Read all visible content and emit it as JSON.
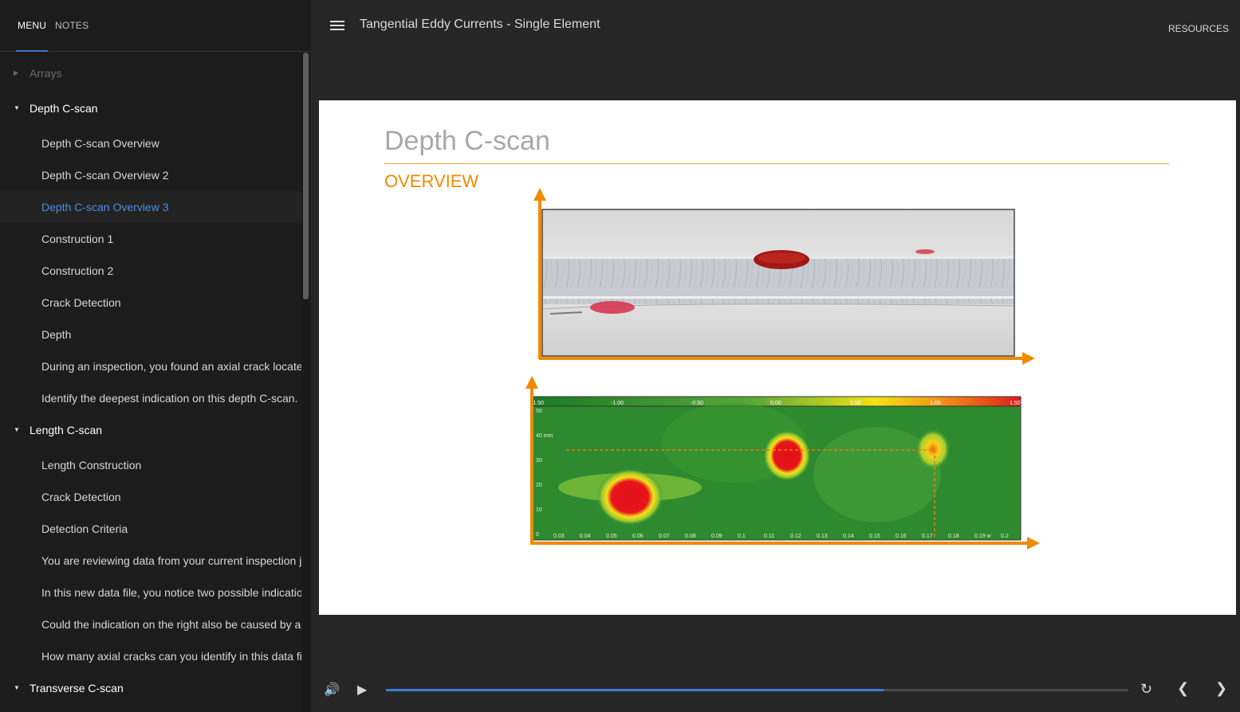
{
  "sidebar": {
    "tabs": {
      "menu": "MENU",
      "notes": "NOTES"
    },
    "rows": [
      {
        "type": "section",
        "label": "Arrays",
        "collapsed": true
      },
      {
        "type": "section",
        "label": "Depth C-scan"
      },
      {
        "type": "item",
        "label": "Depth C-scan Overview"
      },
      {
        "type": "item",
        "label": "Depth C-scan Overview 2"
      },
      {
        "type": "item",
        "label": "Depth C-scan Overview 3",
        "active": true
      },
      {
        "type": "item",
        "label": "Construction 1"
      },
      {
        "type": "item",
        "label": "Construction 2"
      },
      {
        "type": "item",
        "label": "Crack Detection"
      },
      {
        "type": "item",
        "label": "Depth"
      },
      {
        "type": "item",
        "label": "During an inspection, you found an axial crack located n..."
      },
      {
        "type": "item",
        "label": "Identify the deepest indication on this depth C-scan. No..."
      },
      {
        "type": "section",
        "label": "Length C-scan"
      },
      {
        "type": "item",
        "label": "Length Construction"
      },
      {
        "type": "item",
        "label": "Crack Detection"
      },
      {
        "type": "item",
        "label": "Detection Criteria"
      },
      {
        "type": "item",
        "label": "You are reviewing data from your current inspection job..."
      },
      {
        "type": "item",
        "label": "In this new data file, you notice two possible indications..."
      },
      {
        "type": "item",
        "label": "Could the indication on the right also be caused by an ax..."
      },
      {
        "type": "item",
        "label": "How many axial cracks can you identify in this data file."
      },
      {
        "type": "section",
        "label": "Transverse C-scan"
      }
    ]
  },
  "header": {
    "menu_icon": "hamburger-icon",
    "title": "Tangential Eddy Currents - Single Element",
    "resources": "RESOURCES"
  },
  "slide": {
    "title": "Depth C-scan",
    "subtitle": "OVERVIEW",
    "accent_color": "#f08a00",
    "cscan": {
      "top_scale": [
        "-1.50",
        "-1.00",
        "-0.50",
        "0.00",
        "0.50",
        "1.00",
        "1.50"
      ],
      "y_labels": [
        "50",
        "40 mm",
        "30",
        "20",
        "10",
        "0"
      ],
      "x_labels": [
        "0.03",
        "0.04",
        "0.05",
        "0.06",
        "0.07",
        "0.08",
        "0.09",
        "0.1",
        "0.11",
        "0.12",
        "0.13",
        "0.14",
        "0.15",
        "0.16",
        "0.17",
        "0.18",
        "0.19 w",
        "0.2"
      ]
    }
  },
  "player": {
    "volume_icon": "volume-icon",
    "play_icon": "play-icon",
    "progress_fraction": 0.67,
    "replay_icon": "replay-icon",
    "prev_icon": "chevron-left-icon",
    "next_icon": "chevron-right-icon",
    "glyphs": {
      "volume": "🔊",
      "play": "▶",
      "replay": "↻",
      "prev": "❮",
      "next": "❯"
    }
  }
}
